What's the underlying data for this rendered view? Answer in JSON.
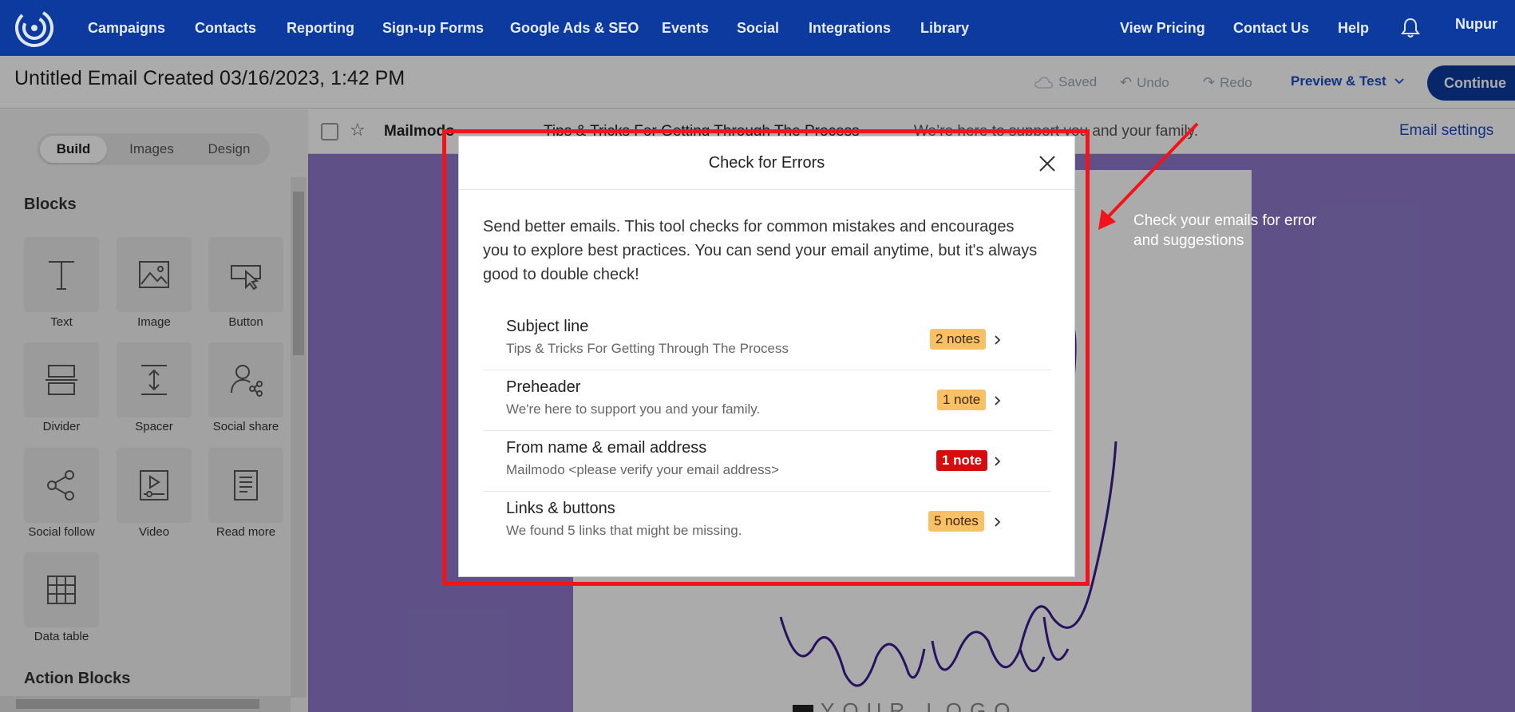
{
  "nav": {
    "left": [
      "Campaigns",
      "Contacts",
      "Reporting",
      "Sign-up Forms",
      "Google Ads & SEO",
      "Events",
      "Social",
      "Integrations",
      "Library"
    ],
    "right": [
      "View Pricing",
      "Contact Us",
      "Help"
    ],
    "user": "Nupur"
  },
  "titlebar": {
    "title": "Untitled Email Created 03/16/2023, 1:42 PM",
    "saved": "Saved",
    "undo": "Undo",
    "redo": "Redo",
    "preview": "Preview & Test",
    "continue": "Continue"
  },
  "sidebar": {
    "tabs": [
      "Build",
      "Images",
      "Design"
    ],
    "active_tab": "Build",
    "blocks_heading": "Blocks",
    "blocks": [
      "Text",
      "Image",
      "Button",
      "Divider",
      "Spacer",
      "Social share",
      "Social follow",
      "Video",
      "Read more",
      "Data table"
    ],
    "action_heading": "Action Blocks"
  },
  "subject_bar": {
    "from": "Mailmodo",
    "subject": "Tips & Tricks For Getting Through The Process",
    "preheader": "– We’re here to support you and your family.",
    "settings": "Email settings"
  },
  "email_preview": {
    "logo_text": "YOUR LOGO"
  },
  "modal": {
    "title": "Check for Errors",
    "intro": "Send better emails. This tool checks for common mistakes and encourages you to explore best practices. You can send your email anytime, but it's always good to double check!",
    "rows": [
      {
        "title": "Subject line",
        "sub": "Tips & Tricks For Getting Through The Process",
        "badge": "2 notes",
        "level": "warn"
      },
      {
        "title": "Preheader",
        "sub": "We're here to support you and your family.",
        "badge": "1 note",
        "level": "warn"
      },
      {
        "title": "From name & email address",
        "sub": "Mailmodo <please verify your email address>",
        "badge": "1 note",
        "level": "error"
      },
      {
        "title": "Links & buttons",
        "sub": "We found 5 links that might be missing.",
        "badge": "5 notes",
        "level": "warn"
      }
    ]
  },
  "annotation": {
    "text": "Check your emails for error and suggestions"
  },
  "colors": {
    "brand": "#0d3a9e",
    "canvas": "#8e7ac9",
    "warn_badge": "#f9c066",
    "error_badge": "#d70d0d",
    "annotation_red": "#f2141a"
  }
}
